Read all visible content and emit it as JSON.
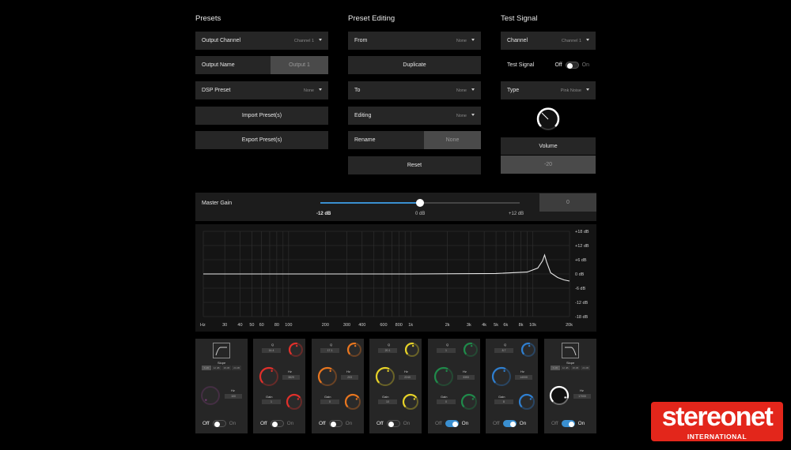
{
  "presets": {
    "title": "Presets",
    "output_channel": {
      "label": "Output Channel",
      "value": "Channel 1"
    },
    "output_name": {
      "label": "Output Name",
      "value": "Output 1"
    },
    "dsp_preset": {
      "label": "DSP Preset",
      "value": "None"
    },
    "import_label": "Import Preset(s)",
    "export_label": "Export Preset(s)"
  },
  "preset_editing": {
    "title": "Preset Editing",
    "from": {
      "label": "From",
      "value": "None"
    },
    "duplicate_label": "Duplicate",
    "to": {
      "label": "To",
      "value": "None"
    },
    "editing": {
      "label": "Editing",
      "value": "None"
    },
    "rename": {
      "label": "Rename",
      "value": "None"
    },
    "reset_label": "Reset"
  },
  "test_signal": {
    "title": "Test Signal",
    "channel": {
      "label": "Channel",
      "value": "Channel 1"
    },
    "test_signal": {
      "label": "Test Signal",
      "off": "Off",
      "on": "On",
      "state": "off"
    },
    "type": {
      "label": "Type",
      "value": "Pink Noise"
    },
    "volume_label": "Volume",
    "volume_value": "-20"
  },
  "master_gain": {
    "label": "Master Gain",
    "min": "-12 dB",
    "mid": "0 dB",
    "max": "+12 dB",
    "value": "0",
    "slider_fraction": 0.5
  },
  "eq_graph": {
    "y_labels": [
      "+18 dB",
      "+12 dB",
      "+6 dB",
      "0 dB",
      "-6 dB",
      "-12 dB",
      "-18 dB"
    ],
    "x_labels": [
      "Hz",
      "30",
      "40",
      "50",
      "60",
      "80",
      "100",
      "200",
      "300",
      "400",
      "600",
      "800",
      "1k",
      "2k",
      "3k",
      "4k",
      "5k",
      "6k",
      "8k",
      "10k",
      "20k"
    ],
    "y_range": [
      -18,
      18
    ],
    "curve": [
      [
        20,
        0
      ],
      [
        1000,
        0
      ],
      [
        5000,
        0.2
      ],
      [
        9000,
        0.8
      ],
      [
        11000,
        2.5
      ],
      [
        12000,
        5.5
      ],
      [
        12500,
        8
      ],
      [
        13000,
        5
      ],
      [
        14000,
        0.5
      ],
      [
        16000,
        -1.5
      ],
      [
        18000,
        -2.5
      ],
      [
        20000,
        -3
      ]
    ]
  },
  "bands": [
    {
      "type": "hp",
      "slope_label": "Slope",
      "slopes": [
        "6 dB",
        "12 dB",
        "18 dB",
        "24 dB"
      ],
      "hz_label": "Hz",
      "hz_value": "100",
      "knob_color": "#7a3b78",
      "knob_level": 0.0,
      "off": "Off",
      "on": "On",
      "state": "off"
    },
    {
      "type": "peq",
      "q_label": "Q",
      "q_value": "14.4",
      "q_color": "#e0302b",
      "hz_label": "Hz",
      "hz_value": "3829",
      "hz_color": "#e0302b",
      "gain_label": "Gain",
      "gain_value": "1",
      "gain_color": "#e0302b",
      "off": "Off",
      "on": "On",
      "state": "off"
    },
    {
      "type": "peq",
      "q_label": "Q",
      "q_value": "17.1",
      "q_color": "#e8761f",
      "hz_label": "Hz",
      "hz_value": "203",
      "hz_color": "#e8761f",
      "gain_label": "Gain",
      "gain_value": "0",
      "gain_color": "#e8761f",
      "off": "Off",
      "on": "On",
      "state": "off"
    },
    {
      "type": "peq",
      "q_label": "Q",
      "q_value": "20.1",
      "q_color": "#e6d228",
      "hz_label": "Hz",
      "hz_value": "2240",
      "hz_color": "#e6d228",
      "gain_label": "Gain",
      "gain_value": "10",
      "gain_color": "#e6d228",
      "off": "Off",
      "on": "On",
      "state": "off"
    },
    {
      "type": "peq",
      "q_label": "Q",
      "q_value": "1",
      "q_color": "#1f8a4a",
      "hz_label": "Hz",
      "hz_value": "3353",
      "hz_color": "#1f8a4a",
      "gain_label": "Gain",
      "gain_value": "0",
      "gain_color": "#1f8a4a",
      "off": "Off",
      "on": "On",
      "state": "on"
    },
    {
      "type": "peq",
      "q_label": "Q",
      "q_value": "8.7",
      "q_color": "#2f7fd0",
      "hz_label": "Hz",
      "hz_value": "14000",
      "hz_color": "#2f7fd0",
      "gain_label": "Gain",
      "gain_value": "8",
      "gain_color": "#2f7fd0",
      "off": "Off",
      "on": "On",
      "state": "on"
    },
    {
      "type": "lp",
      "slope_label": "Slope",
      "slopes": [
        "6 dB",
        "12 dB",
        "18 dB",
        "24 dB"
      ],
      "hz_label": "Hz",
      "hz_value": "17000",
      "knob_color": "#ffffff",
      "knob_level": 0.9,
      "off": "Off",
      "on": "On",
      "state": "on"
    }
  ],
  "logo": {
    "text": "stereonet",
    "subtext": "INTERNATIONAL"
  }
}
